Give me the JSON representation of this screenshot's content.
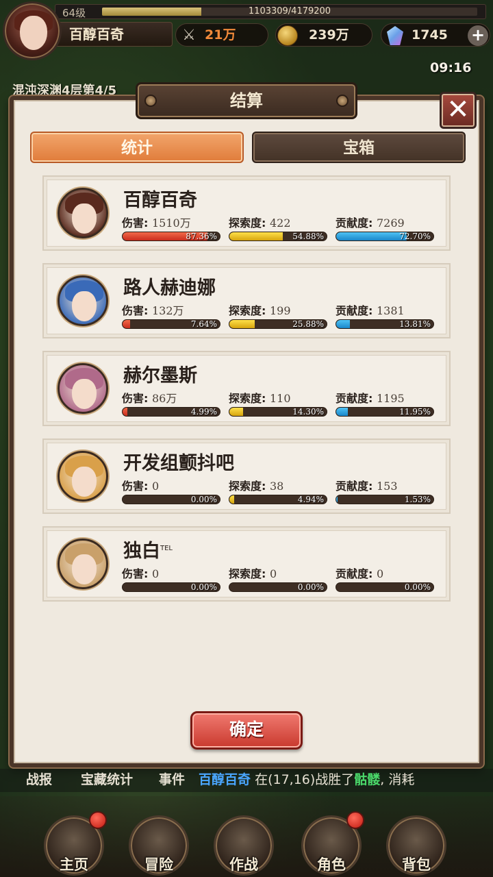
{
  "hud": {
    "level": "64级",
    "exp_text": "1103309/4179200",
    "exp_fraction": 0.264,
    "player_name": "百醇百奇",
    "power": "21万",
    "gold": "239万",
    "gems": "1745",
    "clock": "09:16",
    "location": "混沌深渊4层第4/5"
  },
  "dialog": {
    "title": "结算",
    "tabs": [
      {
        "label": "统计",
        "active": true
      },
      {
        "label": "宝箱",
        "active": false
      }
    ],
    "confirm_label": "确定"
  },
  "labels": {
    "damage": "伤害:",
    "explore": "探索度:",
    "contribution": "贡献度:"
  },
  "players": [
    {
      "name": "百醇百奇",
      "tag": "",
      "damage": "1510万",
      "damage_pct": "87.36%",
      "damage_frac": 0.8736,
      "explore": "422",
      "explore_pct": "54.88%",
      "explore_frac": 0.5488,
      "contribution": "7269",
      "contribution_pct": "72.70%",
      "contribution_frac": 0.727,
      "hair_color": "#5a2a1e"
    },
    {
      "name": "路人赫迪娜",
      "tag": "",
      "damage": "132万",
      "damage_pct": "7.64%",
      "damage_frac": 0.0764,
      "explore": "199",
      "explore_pct": "25.88%",
      "explore_frac": 0.2588,
      "contribution": "1381",
      "contribution_pct": "13.81%",
      "contribution_frac": 0.1381,
      "hair_color": "#3a6ab8"
    },
    {
      "name": "赫尔墨斯",
      "tag": "",
      "damage": "86万",
      "damage_pct": "4.99%",
      "damage_frac": 0.0499,
      "explore": "110",
      "explore_pct": "14.30%",
      "explore_frac": 0.143,
      "contribution": "1195",
      "contribution_pct": "11.95%",
      "contribution_frac": 0.1195,
      "hair_color": "#b06a8a"
    },
    {
      "name": "开发组颤抖吧",
      "tag": "",
      "damage": "0",
      "damage_pct": "0.00%",
      "damage_frac": 0,
      "explore": "38",
      "explore_pct": "4.94%",
      "explore_frac": 0.0494,
      "contribution": "153",
      "contribution_pct": "1.53%",
      "contribution_frac": 0.0153,
      "hair_color": "#d9a04a"
    },
    {
      "name": "独白",
      "tag": "TEL",
      "damage": "0",
      "damage_pct": "0.00%",
      "damage_frac": 0,
      "explore": "0",
      "explore_pct": "0.00%",
      "explore_frac": 0,
      "contribution": "0",
      "contribution_pct": "0.00%",
      "contribution_frac": 0,
      "hair_color": "#c9a06a"
    }
  ],
  "ticker": {
    "tab1": "战报",
    "tab2": "宝藏统计",
    "tab3": "事件",
    "msg_name": "百醇百奇",
    "msg_mid": "在(17,16)战胜了",
    "msg_monster": "骷髅",
    "msg_end": ", 消耗"
  },
  "nav": [
    {
      "label": "主页",
      "icon": "home-icon",
      "badge": true
    },
    {
      "label": "冒险",
      "icon": "adventure-icon",
      "badge": false
    },
    {
      "label": "作战",
      "icon": "battle-icon",
      "badge": false
    },
    {
      "label": "角色",
      "icon": "character-icon",
      "badge": true
    },
    {
      "label": "背包",
      "icon": "backpack-icon",
      "badge": false
    }
  ]
}
